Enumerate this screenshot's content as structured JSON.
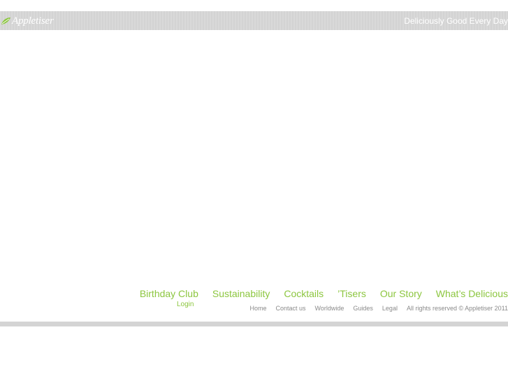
{
  "header": {
    "logo_text": "Appletiser",
    "tagline": "Deliciously Good Every Day"
  },
  "nav": {
    "items": [
      {
        "label": "Birthday Club"
      },
      {
        "label": "Sustainability"
      },
      {
        "label": "Cocktails"
      },
      {
        "label": "’Tisers"
      },
      {
        "label": "Our Story"
      },
      {
        "label": "What’s Delicious"
      }
    ],
    "login_label": "Login"
  },
  "footer": {
    "links": [
      {
        "label": "Home"
      },
      {
        "label": "Contact us"
      },
      {
        "label": "Worldwide"
      },
      {
        "label": "Guides"
      },
      {
        "label": "Legal"
      }
    ],
    "copyright": "All rights reserved © Appletiser 2011"
  },
  "colors": {
    "accent": "#8cc63f",
    "bar": "#d7d7d7",
    "footer_text": "#8a8a8a"
  }
}
